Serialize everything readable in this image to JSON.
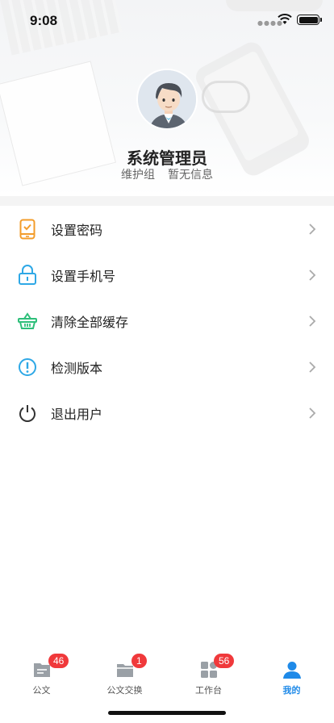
{
  "status_bar": {
    "time": "9:08"
  },
  "profile": {
    "name": "系统管理员",
    "group": "维护组",
    "info": "暂无信息"
  },
  "menu": {
    "items": [
      {
        "label": "设置密码",
        "icon": "phone-check-icon",
        "color": "#f39c2a"
      },
      {
        "label": "设置手机号",
        "icon": "lock-icon",
        "color": "#2ea8e6"
      },
      {
        "label": "清除全部缓存",
        "icon": "basket-icon",
        "color": "#2ebf7a"
      },
      {
        "label": "检测版本",
        "icon": "alert-circle-icon",
        "color": "#2ea8e6"
      },
      {
        "label": "退出用户",
        "icon": "power-icon",
        "color": "#333333"
      }
    ]
  },
  "tabbar": {
    "tabs": [
      {
        "label": "公文",
        "badge": "46",
        "icon": "document-icon"
      },
      {
        "label": "公文交换",
        "badge": "1",
        "icon": "folder-icon"
      },
      {
        "label": "工作台",
        "badge": "56",
        "icon": "grid-icon"
      },
      {
        "label": "我的",
        "badge": "",
        "icon": "user-icon"
      }
    ],
    "active_color": "#1f8ae8",
    "badge_color": "#f0393b"
  }
}
